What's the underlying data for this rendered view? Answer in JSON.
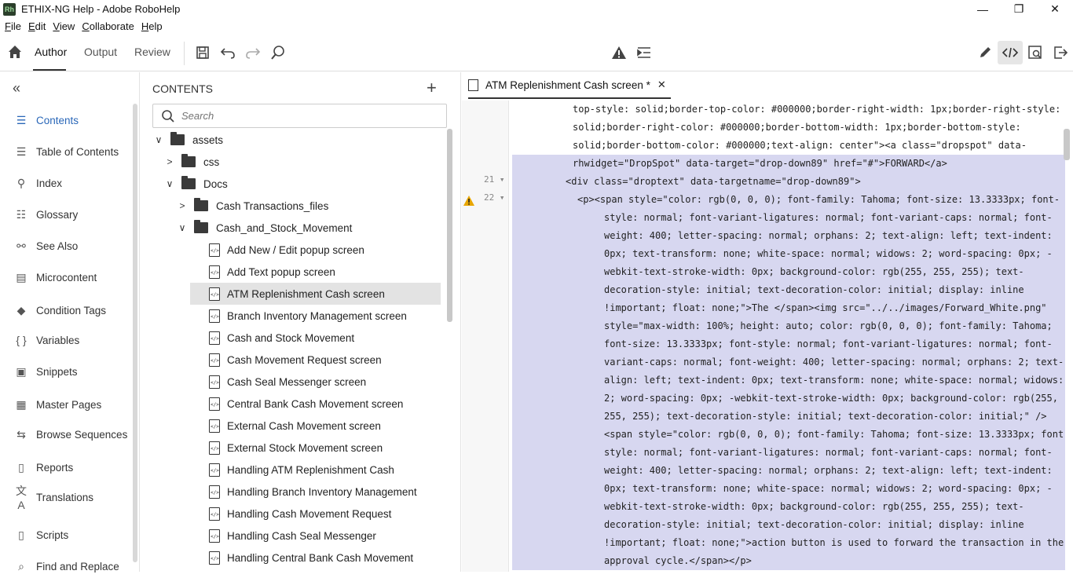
{
  "window": {
    "app_icon_text": "Rh",
    "title": "ETHIX-NG Help - Adobe RoboHelp",
    "minimize": "—",
    "restore": "❐",
    "close": "✕"
  },
  "menu": {
    "items": [
      {
        "u": "F",
        "rest": "ile"
      },
      {
        "u": "E",
        "rest": "dit"
      },
      {
        "u": "V",
        "rest": "iew"
      },
      {
        "u": "C",
        "rest": "ollaborate"
      },
      {
        "u": "H",
        "rest": "elp"
      }
    ]
  },
  "toolbar": {
    "tabs": [
      "Author",
      "Output",
      "Review"
    ]
  },
  "sidebar": {
    "collapse_icon": "«",
    "items": [
      {
        "label": "Contents",
        "icon": "contents-icon",
        "glyph": "☰"
      },
      {
        "label": "Table of Contents",
        "icon": "toc-icon",
        "glyph": "☰"
      },
      {
        "label": "Index",
        "icon": "index-icon",
        "glyph": "⚲"
      },
      {
        "label": "Glossary",
        "icon": "glossary-icon",
        "glyph": "☷"
      },
      {
        "label": "See Also",
        "icon": "see-also-icon",
        "glyph": "⚯"
      },
      {
        "label": "Microcontent",
        "icon": "microcontent-icon",
        "glyph": "▤"
      },
      {
        "label": "Condition Tags",
        "icon": "tag-icon",
        "glyph": "◆"
      },
      {
        "label": "Variables",
        "icon": "variables-icon",
        "glyph": "{ }"
      },
      {
        "label": "Snippets",
        "icon": "snippets-icon",
        "glyph": "▣"
      },
      {
        "label": "Master Pages",
        "icon": "master-pages-icon",
        "glyph": "▦"
      },
      {
        "label": "Browse Sequences",
        "icon": "browse-sequences-icon",
        "glyph": "⇆"
      },
      {
        "label": "Reports",
        "icon": "reports-icon",
        "glyph": "▯"
      },
      {
        "label": "Translations",
        "icon": "translations-icon",
        "glyph": "文A"
      },
      {
        "label": "Scripts",
        "icon": "scripts-icon",
        "glyph": "▯"
      },
      {
        "label": "Find and Replace",
        "icon": "find-replace-icon",
        "glyph": "⌕"
      }
    ]
  },
  "contents": {
    "title": "CONTENTS",
    "add_label": "+",
    "search_placeholder": "Search",
    "tree": [
      {
        "label": "assets",
        "type": "folder",
        "chev": "∨"
      },
      {
        "label": "css",
        "type": "folder",
        "chev": ">"
      },
      {
        "label": "Docs",
        "type": "folder",
        "chev": "∨"
      },
      {
        "label": "Cash Transactions_files",
        "type": "folder",
        "chev": ">"
      },
      {
        "label": "Cash_and_Stock_Movement",
        "type": "folder",
        "chev": "∨"
      },
      {
        "label": "Add New / Edit popup screen",
        "type": "file"
      },
      {
        "label": "Add Text popup screen",
        "type": "file"
      },
      {
        "label": "ATM Replenishment Cash screen",
        "type": "file"
      },
      {
        "label": "Branch Inventory Management screen",
        "type": "file"
      },
      {
        "label": "Cash and Stock Movement",
        "type": "file"
      },
      {
        "label": "Cash Movement Request screen",
        "type": "file"
      },
      {
        "label": "Cash Seal Messenger screen",
        "type": "file"
      },
      {
        "label": "Central Bank Cash Movement screen",
        "type": "file"
      },
      {
        "label": "External Cash Movement screen",
        "type": "file"
      },
      {
        "label": "External Stock Movement screen",
        "type": "file"
      },
      {
        "label": "Handling ATM Replenishment Cash",
        "type": "file"
      },
      {
        "label": "Handling Branch Inventory Management",
        "type": "file"
      },
      {
        "label": "Handling Cash Movement Request",
        "type": "file"
      },
      {
        "label": "Handling Cash Seal Messenger",
        "type": "file"
      },
      {
        "label": "Handling Central Bank Cash Movement",
        "type": "file"
      }
    ]
  },
  "editor": {
    "tab_label": "ATM Replenishment Cash screen *",
    "tab_close": "✕",
    "line_numbers": [
      "21",
      "22"
    ],
    "fold_marker": "▾",
    "lines": [
      "top-style: solid;border-top-color: #000000;border-right-width: 1px;border-right-style:",
      "solid;border-right-color: #000000;border-bottom-width: 1px;border-bottom-style:",
      "solid;border-bottom-color: #000000;text-align: center\"><a class=\"dropspot\" data-",
      "rhwidget=\"DropSpot\" data-target=\"drop-down89\" href=\"#\">FORWARD</a>",
      "<div class=\"droptext\" data-targetname=\"drop-down89\">",
      "<p><span style=\"color: rgb(0, 0, 0); font-family: Tahoma; font-size: 13.3333px; font-",
      "style: normal; font-variant-ligatures: normal; font-variant-caps: normal; font-",
      "weight: 400; letter-spacing: normal; orphans: 2; text-align: left; text-indent:",
      "0px; text-transform: none; white-space: normal; widows: 2; word-spacing: 0px; -",
      "webkit-text-stroke-width: 0px; background-color: rgb(255, 255, 255); text-",
      "decoration-style: initial; text-decoration-color: initial; display: inline",
      "!important; float: none;\">The </span><img src=\"../../images/Forward_White.png\"",
      "style=\"max-width: 100%; height: auto; color: rgb(0, 0, 0); font-family: Tahoma;",
      "font-size: 13.3333px; font-style: normal; font-variant-ligatures: normal; font-",
      "variant-caps: normal; font-weight: 400; letter-spacing: normal; orphans: 2; text-",
      "align: left; text-indent: 0px; text-transform: none; white-space: normal; widows:",
      "2; word-spacing: 0px; -webkit-text-stroke-width: 0px; background-color: rgb(255,",
      "255, 255); text-decoration-style: initial; text-decoration-color: initial;\" />",
      "<span style=\"color: rgb(0, 0, 0); font-family: Tahoma; font-size: 13.3333px; font-",
      "style: normal; font-variant-ligatures: normal; font-variant-caps: normal; font-",
      "weight: 400; letter-spacing: normal; orphans: 2; text-align: left; text-indent:",
      "0px; text-transform: none; white-space: normal; widows: 2; word-spacing: 0px; -",
      "webkit-text-stroke-width: 0px; background-color: rgb(255, 255, 255); text-",
      "decoration-style: initial; text-decoration-color: initial; display: inline",
      "!important; float: none;\">action button is used to forward the transaction in the",
      "approval cycle.</span></p>"
    ]
  },
  "colors": {
    "accent": "#2a67b8",
    "selection": "#d7d7f0",
    "warning": "#e8a600"
  }
}
